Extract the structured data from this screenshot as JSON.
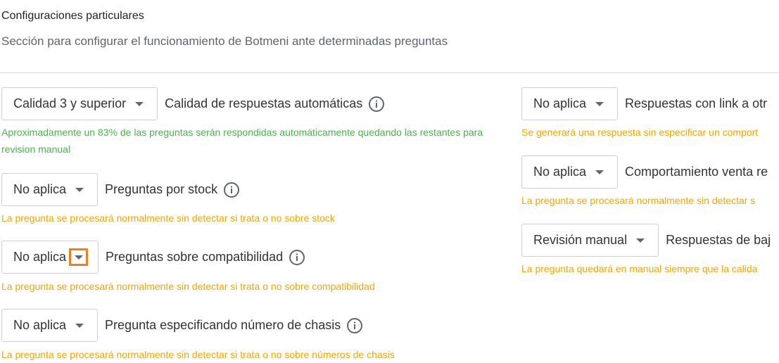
{
  "header": {
    "title": "Configuraciones particulares",
    "subtitle": "Sección para configurar el funcionamiento de Botmeni ante determinadas preguntas"
  },
  "left": [
    {
      "select_value": "Calidad 3 y superior",
      "label": "Calidad de respuestas automáticas",
      "has_info": true,
      "helper": "Aproximadamente un 83% de las preguntas serán respondidas automáticamente quedando las restantes para revision manual",
      "helper_color": "#4caf50"
    },
    {
      "select_value": "No aplica",
      "label": "Preguntas por stock",
      "has_info": true,
      "helper": "La pregunta se procesará normalmente sin detectar si trata o no sobre stock",
      "helper_color": "#f5a300"
    },
    {
      "select_value": "No aplica",
      "label": "Preguntas sobre compatibilidad",
      "has_info": true,
      "helper": "La pregunta se procesará normalmente sin detectar si trata o no sobre compatibilidad",
      "helper_color": "#f5a300"
    },
    {
      "select_value": "No aplica",
      "label": "Pregunta especificando número de chasis",
      "has_info": true,
      "helper": "La pregunta se procesará normalmente sin detectar si trata o no sobre números de chasis",
      "helper_color": "#f5a300"
    }
  ],
  "right": [
    {
      "select_value": "No aplica",
      "label": "Respuestas con link a otr",
      "helper": "Se generará una respuesta sin especificar un comport",
      "helper_color": "#f5a300"
    },
    {
      "select_value": "No aplica",
      "label": "Comportamiento venta re",
      "helper": "La pregunta se procesará normalmente sin detectar s",
      "helper_color": "#f5a300"
    },
    {
      "select_value": "Revisión manual",
      "label": "Respuestas de baj",
      "helper": "La pregunta quedará en manual siempre que la calida",
      "helper_color": "#f5a300"
    }
  ],
  "icons": {
    "dropdown": "caret-down-icon",
    "info": "info-circle-icon"
  },
  "colors": {
    "focus_outline": "#f57c1f",
    "helper_success": "#4caf50",
    "helper_warning": "#f5a300"
  }
}
